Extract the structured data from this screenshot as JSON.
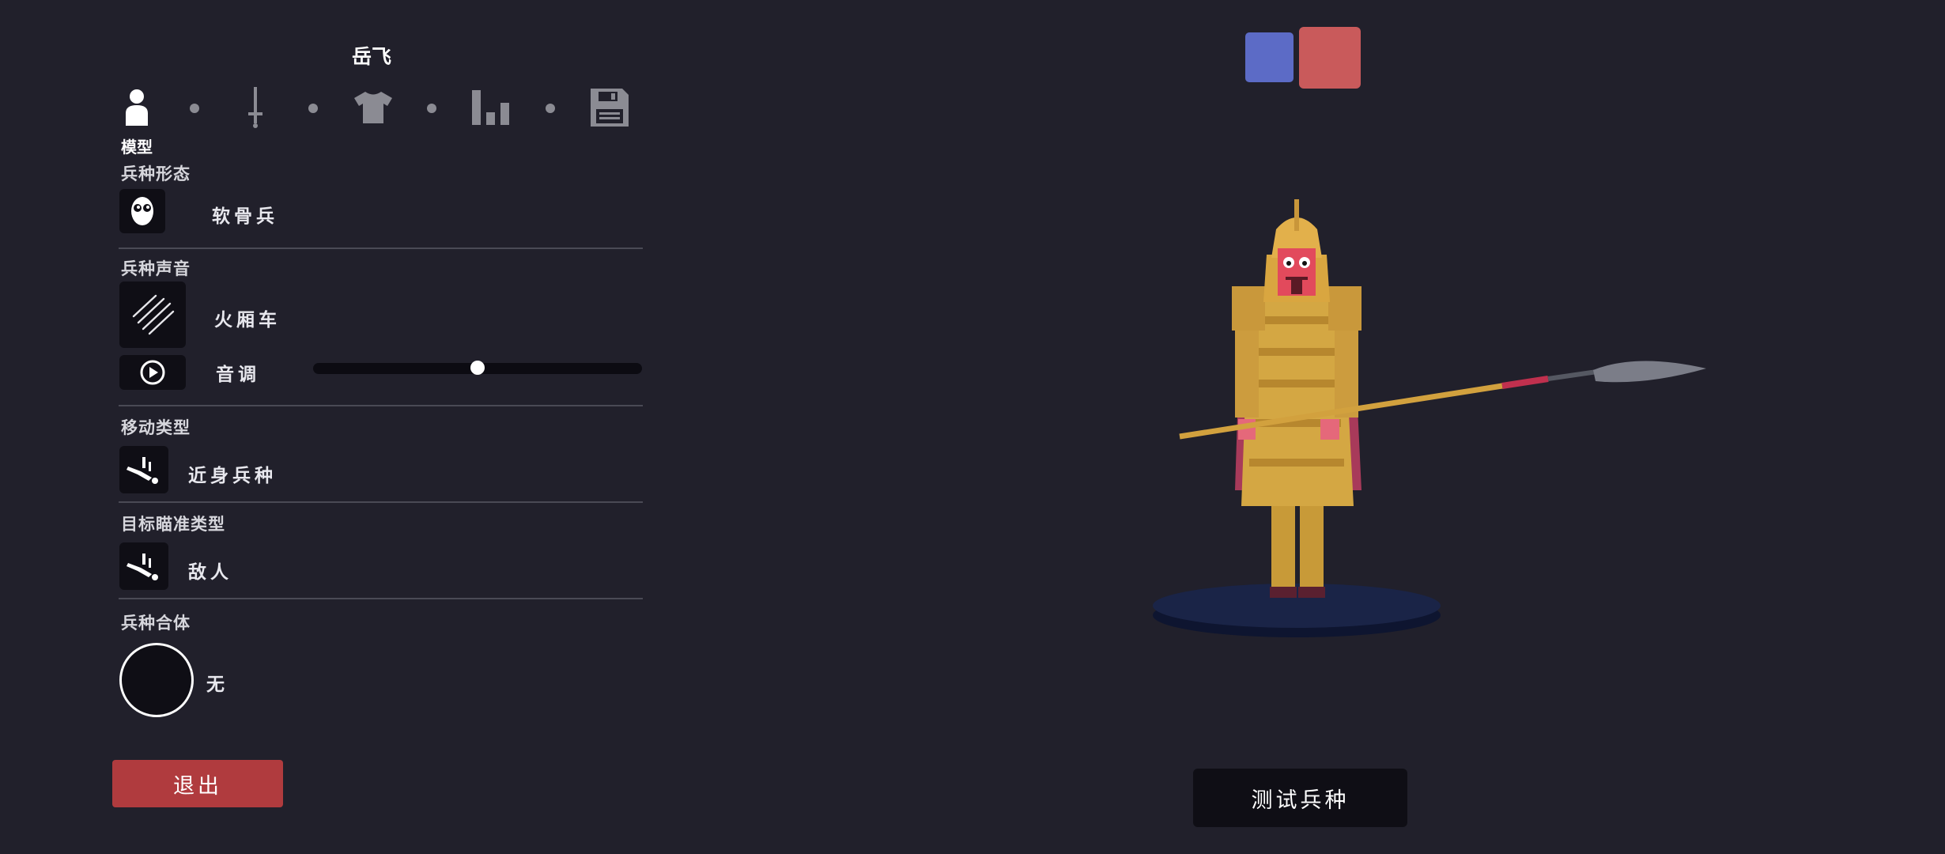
{
  "unit_name": "岳飞",
  "steps": {
    "icons": [
      "person-icon",
      "sword-icon",
      "shirt-icon",
      "bar-chart-icon",
      "save-icon"
    ],
    "active_label": "模型"
  },
  "body_type": {
    "label": "兵种形态",
    "value": "软骨兵"
  },
  "voice": {
    "label": "兵种声音",
    "value": "火厢车",
    "pitch_label": "音调",
    "pitch_level": 0.5
  },
  "movement": {
    "label": "移动类型",
    "value": "近身兵种"
  },
  "targeting": {
    "label": "目标瞄准类型",
    "value": "敌人"
  },
  "combine": {
    "label": "兵种合体",
    "value": "无"
  },
  "buttons": {
    "exit": "退出",
    "test": "测试兵种"
  },
  "team_colors": {
    "blue": "#5c6bc6",
    "red": "#c95a5b"
  },
  "accent_colors": {
    "exit": "#b03b3e",
    "background": "#21202b"
  }
}
